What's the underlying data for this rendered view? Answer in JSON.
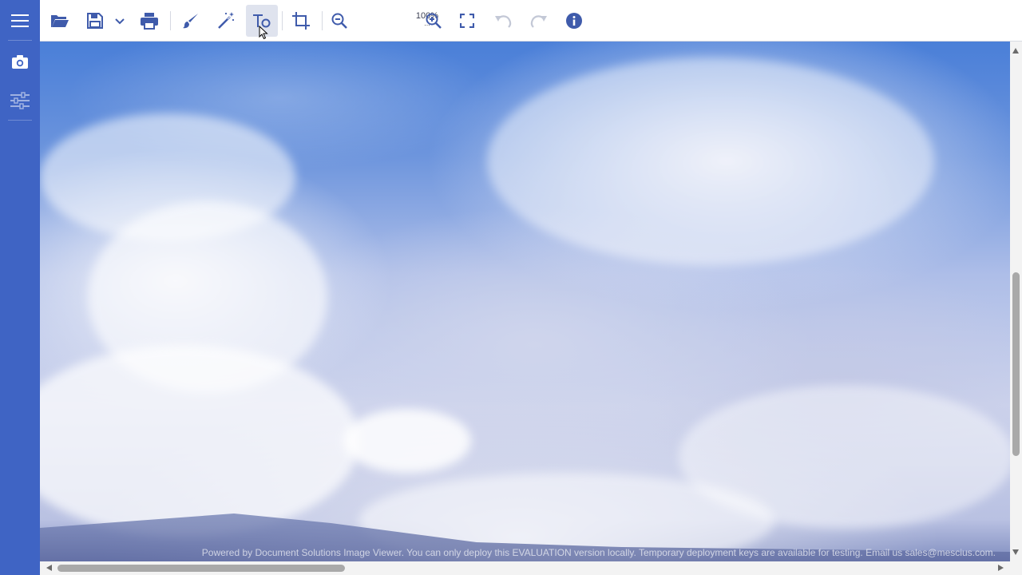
{
  "sidebar": {
    "items": [
      {
        "name": "menu-icon"
      },
      {
        "name": "camera-icon"
      },
      {
        "name": "sliders-icon"
      }
    ]
  },
  "toolbar": {
    "zoom_label": "100%",
    "zoom_dots": "...",
    "icons": [
      "folder-open-icon",
      "save-icon",
      "chevron-down-icon",
      "print-icon",
      "brush-icon",
      "magic-wand-icon",
      "text-tool-icon",
      "crop-icon",
      "zoom-out-icon",
      "zoom-in-icon",
      "fullscreen-icon",
      "undo-icon",
      "redo-icon",
      "info-icon"
    ]
  },
  "viewport": {
    "watermark": "Powered by Document Solutions Image Viewer. You can only deploy this EVALUATION version locally. Temporary deployment keys are available for testing. Email us sales@mescius.com."
  },
  "colors": {
    "sidebar": "#3f64c4",
    "icon": "#3f5bab",
    "active_bg": "#dfe3ee"
  }
}
